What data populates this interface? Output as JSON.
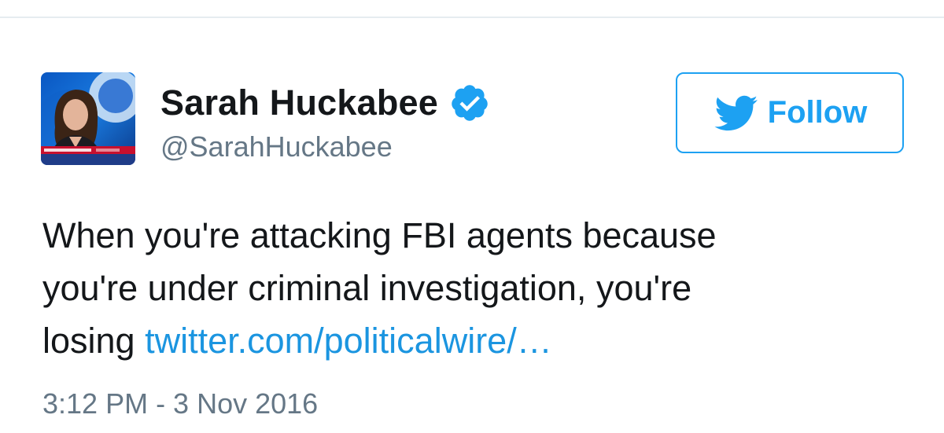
{
  "tweet": {
    "author": {
      "display_name": "Sarah Huckabee",
      "handle": "@SarahHuckabee",
      "verified_icon": "verified-badge-icon",
      "avatar": "profile-photo"
    },
    "follow_button": {
      "label": "Follow",
      "icon": "twitter-bird-icon"
    },
    "text_parts": {
      "line1": "When you're attacking FBI agents because",
      "line2": "you're under criminal investigation, you're",
      "line3_prefix": "losing ",
      "link": "twitter.com/politicalwire/…"
    },
    "timestamp": "3:12 PM - 3 Nov 2016"
  },
  "colors": {
    "accent": "#1da1f2",
    "link": "#1b95e0",
    "text": "#14171a",
    "secondary": "#657786",
    "divider": "#e6ecf0"
  }
}
